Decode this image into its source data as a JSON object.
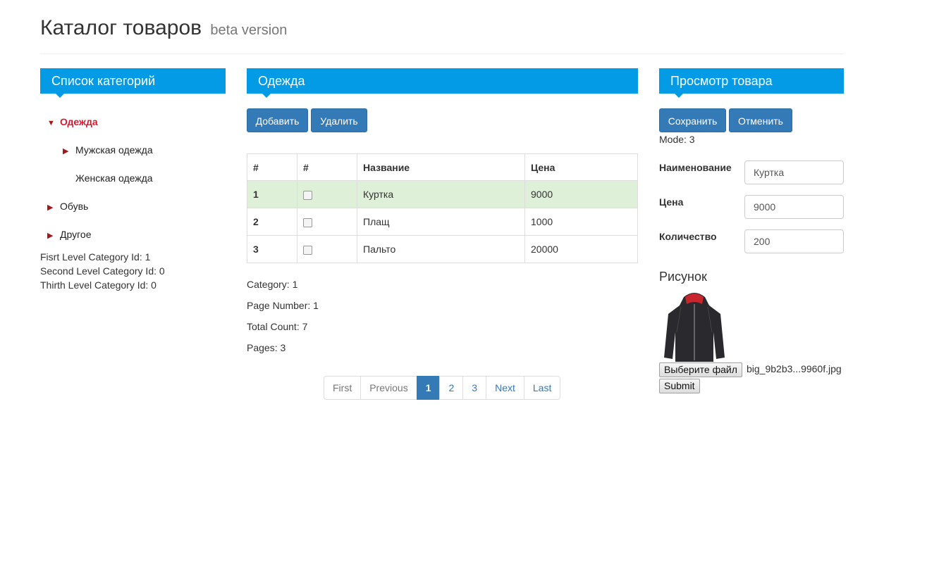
{
  "header": {
    "title": "Каталог товаров",
    "subtitle": "beta version"
  },
  "categories_panel": {
    "heading": "Список категорий",
    "items": [
      {
        "label": "Одежда",
        "arrow": "▼",
        "active": true
      },
      {
        "label": "Мужская одежда",
        "arrow": "▶"
      },
      {
        "label": "Женская одежда",
        "arrow": ""
      },
      {
        "label": "Обувь",
        "arrow": "▶"
      },
      {
        "label": "Другое",
        "arrow": "▶"
      }
    ],
    "info": [
      "Fisrt Level Category Id: 1",
      "Second Level Category Id: 0",
      "Thirth Level Category Id: 0"
    ]
  },
  "products_panel": {
    "heading": "Одежда",
    "add_label": "Добавить",
    "delete_label": "Удалить",
    "columns": [
      "#",
      "#",
      "Название",
      "Цена"
    ],
    "rows": [
      {
        "id": "1",
        "name": "Куртка",
        "price": "9000",
        "selected": true
      },
      {
        "id": "2",
        "name": "Плащ",
        "price": "1000",
        "selected": false
      },
      {
        "id": "3",
        "name": "Пальто",
        "price": "20000",
        "selected": false
      }
    ],
    "meta": {
      "category": "Category: 1",
      "page_number": "Page Number: 1",
      "total_count": "Total Count: 7",
      "pages": "Pages: 3"
    },
    "pagination": {
      "first": "First",
      "previous": "Previous",
      "pages": [
        "1",
        "2",
        "3"
      ],
      "active_page": "1",
      "next": "Next",
      "last": "Last"
    }
  },
  "view_panel": {
    "heading": "Просмотр товара",
    "save_label": "Сохранить",
    "cancel_label": "Отменить",
    "mode": "Mode: 3",
    "fields": {
      "name_label": "Наименование",
      "name_value": "Куртка",
      "price_label": "Цена",
      "price_value": "9000",
      "qty_label": "Количество",
      "qty_value": "200"
    },
    "image_title": "Рисунок",
    "file_button": "Выберите файл",
    "file_name": "big_9b2b3...9960f.jpg",
    "submit_label": "Submit"
  },
  "colors": {
    "panel_heading": "#039be5",
    "primary_button": "#337ab7",
    "active_category": "#d9182d",
    "arrow": "#a0171c",
    "selected_row": "#dff0d8"
  }
}
